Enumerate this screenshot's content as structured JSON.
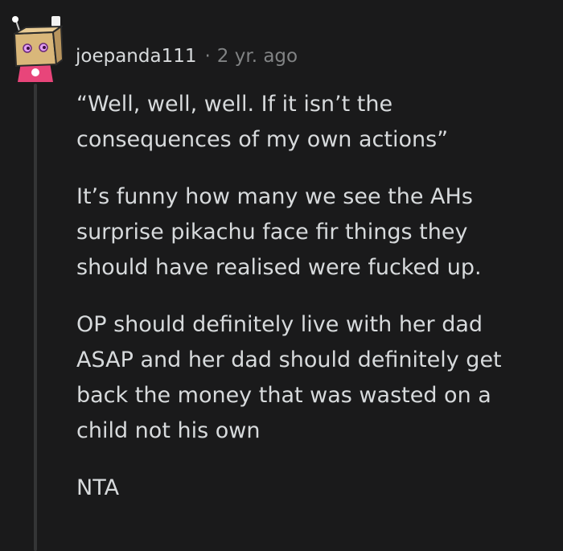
{
  "comment": {
    "author": "joepanda111",
    "separator": "·",
    "time": "2 yr. ago",
    "avatar_icon": "box-head-avatar-icon",
    "paragraphs": [
      "“Well, well, well. If it isn’t the\nconsequences of my own actions”",
      "It’s funny how many we see the AHs\nsurprise pikachu face fir things they\nshould have realised were fucked up.",
      "OP should definitely live with her dad\nASAP and her dad should definitely get\nback the money that was wasted on a\nchild not his own",
      "NTA"
    ]
  },
  "colors": {
    "background": "#1a1a1b",
    "text": "#d7dadc",
    "meta": "#818384",
    "thread_line": "#343536",
    "avatar_pink": "#e8457a",
    "avatar_box": "#d9b77a"
  }
}
